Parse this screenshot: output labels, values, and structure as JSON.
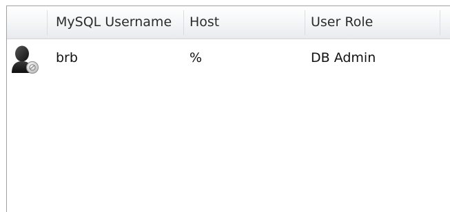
{
  "table": {
    "columns": [
      {
        "label": ""
      },
      {
        "label": "MySQL Username"
      },
      {
        "label": "Host"
      },
      {
        "label": "User Role"
      }
    ],
    "rows": [
      {
        "icon": "user-avatar-icon",
        "username": "brb",
        "host": "%",
        "role": "DB Admin"
      }
    ]
  }
}
